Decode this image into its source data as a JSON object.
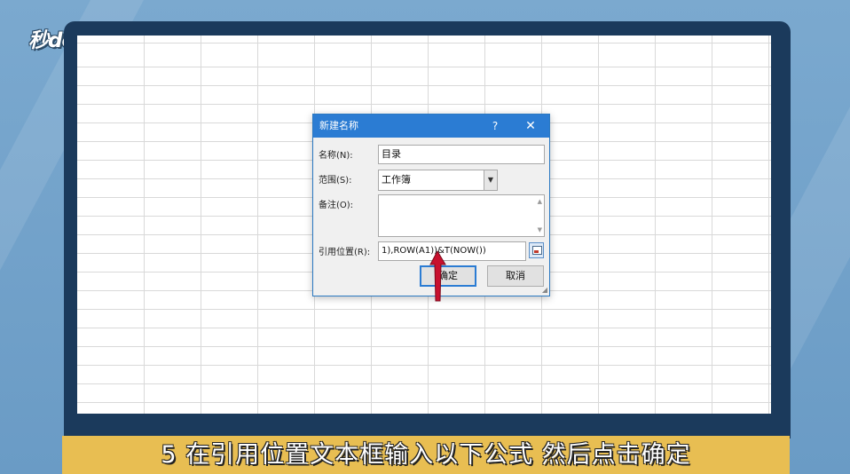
{
  "watermark": {
    "logo_text": "秒dong视频"
  },
  "dialog": {
    "title": "新建名称",
    "help_label": "?",
    "close_label": "✕",
    "name_label": "名称(N):",
    "name_value": "目录",
    "scope_label": "范围(S):",
    "scope_value": "工作簿",
    "comment_label": "备注(O):",
    "comment_value": "",
    "refers_label": "引用位置(R):",
    "refers_value": "1),ROW(A1))&T(NOW())",
    "ok_label": "确定",
    "cancel_label": "取消"
  },
  "caption": {
    "text": "5 在引用位置文本框输入以下公式 然后点击确定"
  },
  "colors": {
    "background": "#7ba9cf",
    "monitor_frame": "#1b3a5c",
    "titlebar": "#2b7cd3",
    "caption_bar": "#e8be52",
    "pointer": "#c8102e"
  },
  "icons": {
    "collapse_ref": "range-select-icon",
    "pointer": "red-arrow-pointer",
    "dropdown": "chevron-down-icon"
  }
}
